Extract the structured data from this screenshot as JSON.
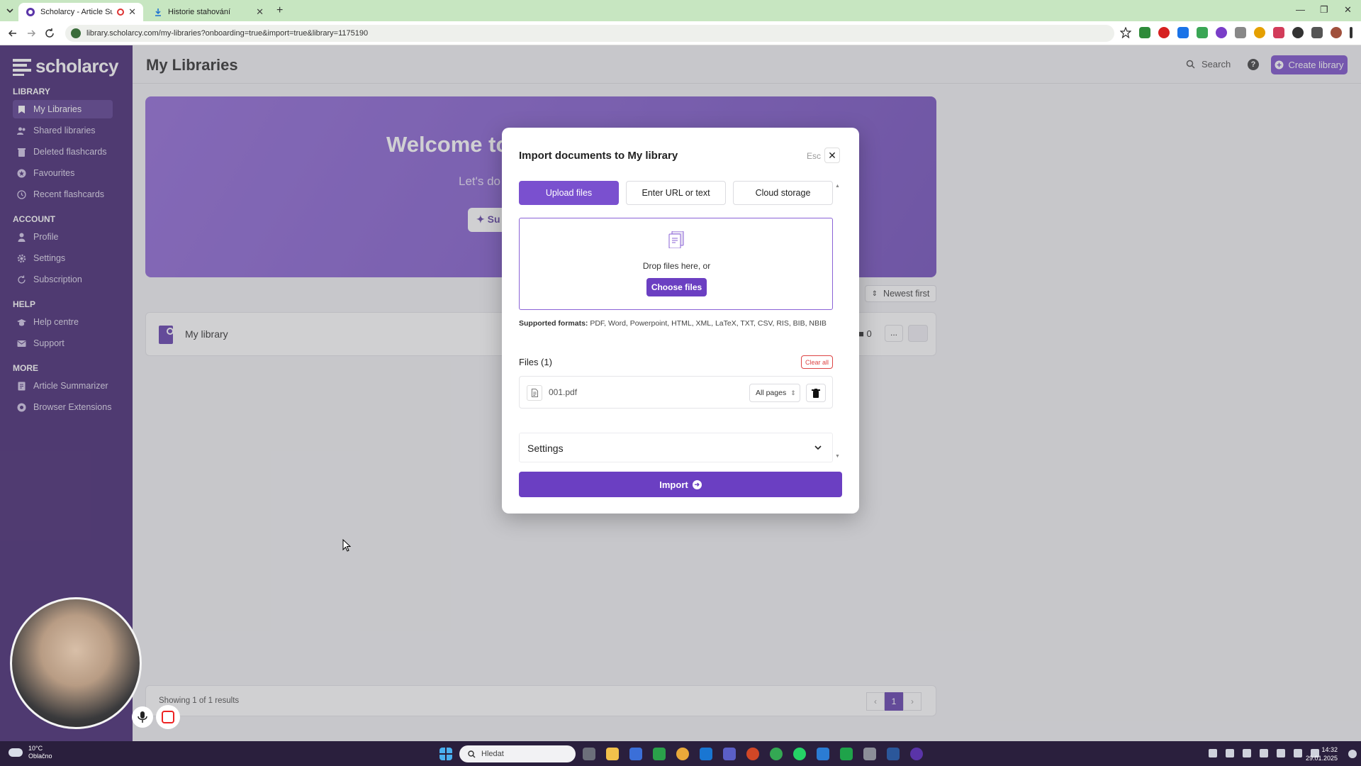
{
  "browser": {
    "tabs": [
      {
        "title": "Scholarcy - Article Summari",
        "active": true
      },
      {
        "title": "Historie stahování",
        "active": false
      }
    ],
    "url": "library.scholarcy.com/my-libraries?onboarding=true&import=true&library=1175190"
  },
  "sidebar": {
    "logo": "scholarcy",
    "sections": [
      {
        "title": "LIBRARY",
        "items": [
          "My Libraries",
          "Shared libraries",
          "Deleted flashcards",
          "Favourites",
          "Recent flashcards"
        ]
      },
      {
        "title": "ACCOUNT",
        "items": [
          "Profile",
          "Settings",
          "Subscription"
        ]
      },
      {
        "title": "HELP",
        "items": [
          "Help centre",
          "Support"
        ]
      },
      {
        "title": "MORE",
        "items": [
          "Article Summarizer",
          "Browser Extensions"
        ]
      }
    ]
  },
  "header": {
    "title": "My Libraries",
    "search_label": "Search",
    "help_label": "?",
    "create_label": "Create library"
  },
  "hero": {
    "title": "Welcome to",
    "subtitle": "Let's do",
    "button_label": "Su"
  },
  "sort": {
    "label": "Newest first"
  },
  "library_row": {
    "name": "My library",
    "count": "0",
    "more_label": "..."
  },
  "footer": {
    "results_text": "Showing 1 of 1 results",
    "current_page": "1"
  },
  "modal": {
    "title": "Import documents to My library",
    "esc_label": "Esc",
    "tabs": [
      "Upload files",
      "Enter URL or text",
      "Cloud storage"
    ],
    "drop_text": "Drop files here, or",
    "choose_label": "Choose files",
    "formats_label": "Supported formats:",
    "formats_list": "PDF, Word, Powerpoint, HTML, XML, LaTeX, TXT, CSV, RIS, BIB, NBIB",
    "files_title": "Files (1)",
    "clear_all_label": "Clear all",
    "file": {
      "name": "001.pdf",
      "pages": "All pages"
    },
    "settings_label": "Settings",
    "import_label": "Import"
  },
  "taskbar": {
    "weather_temp": "10°C",
    "weather_desc": "Oblačno",
    "search_placeholder": "Hledat",
    "time": "14:32",
    "date": "29.01.2025"
  },
  "colors": {
    "brand": "#6b3fc2",
    "sidebar": "#3a1a6b",
    "danger": "#dd4444"
  }
}
